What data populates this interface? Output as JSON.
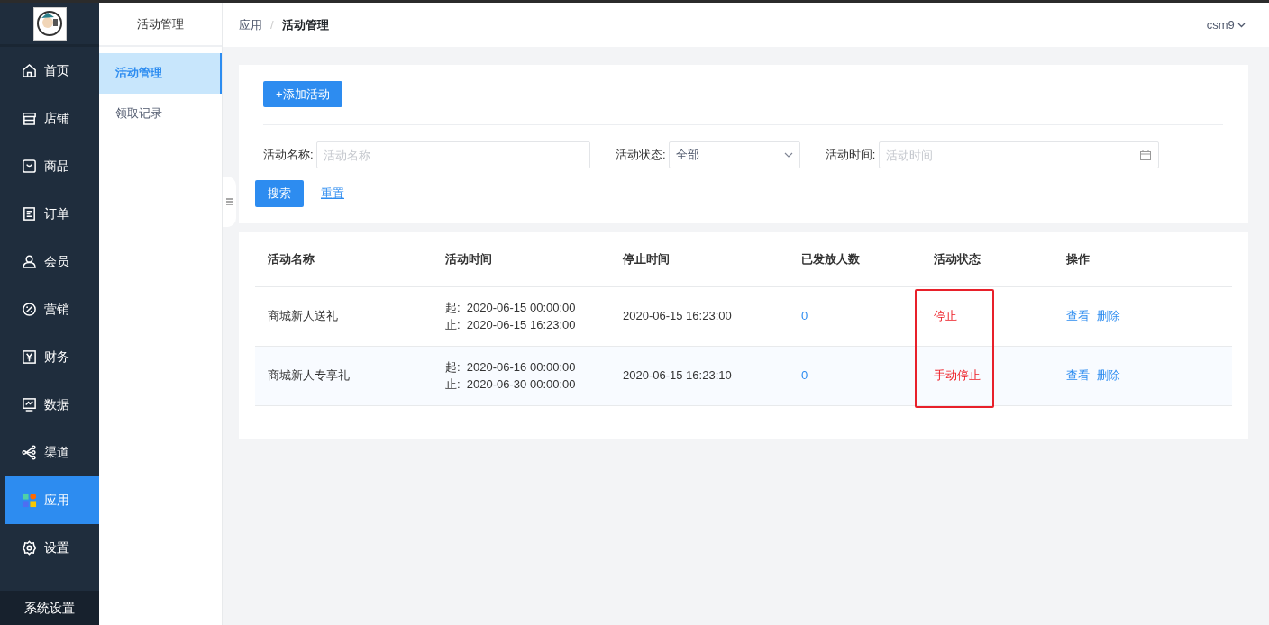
{
  "nav": {
    "items": [
      {
        "label": "首页",
        "selected": false
      },
      {
        "label": "店铺",
        "selected": false
      },
      {
        "label": "商品",
        "selected": false
      },
      {
        "label": "订单",
        "selected": false
      },
      {
        "label": "会员",
        "selected": false
      },
      {
        "label": "营销",
        "selected": false
      },
      {
        "label": "财务",
        "selected": false
      },
      {
        "label": "数据",
        "selected": false
      },
      {
        "label": "渠道",
        "selected": false
      },
      {
        "label": "应用",
        "selected": true
      },
      {
        "label": "设置",
        "selected": false
      }
    ],
    "footer": "系统设置"
  },
  "submenu": {
    "title": "活动管理",
    "items": [
      {
        "label": "活动管理",
        "selected": true
      },
      {
        "label": "领取记录",
        "selected": false
      }
    ]
  },
  "header": {
    "breadcrumb": [
      "应用",
      "活动管理"
    ],
    "separator": "/",
    "user": "csm9"
  },
  "toolbar": {
    "add_button": "+添加活动"
  },
  "filters": [
    {
      "kind": "text",
      "label": "活动名称:",
      "placeholder": "活动名称"
    },
    {
      "kind": "select",
      "label": "活动状态:",
      "value": "全部"
    },
    {
      "kind": "date",
      "label": "活动时间:",
      "placeholder": "活动时间"
    }
  ],
  "search_button": "搜索",
  "reset_link": "重置",
  "table": {
    "columns": [
      "活动名称",
      "活动时间",
      "停止时间",
      "已发放人数",
      "活动状态",
      "操作"
    ],
    "rows": [
      {
        "name": "商城新人送礼",
        "start": "起:  2020-06-15 00:00:00",
        "end": "止:  2020-06-15 16:23:00",
        "stop_time": "2020-06-15 16:23:00",
        "issued": "0",
        "status": "停止",
        "actions": [
          "查看",
          "删除"
        ]
      },
      {
        "name": "商城新人专享礼",
        "start": "起:  2020-06-16 00:00:00",
        "end": "止:  2020-06-30 00:00:00",
        "stop_time": "2020-06-15 16:23:10",
        "issued": "0",
        "status": "手动停止",
        "actions": [
          "查看",
          "删除"
        ]
      }
    ]
  }
}
